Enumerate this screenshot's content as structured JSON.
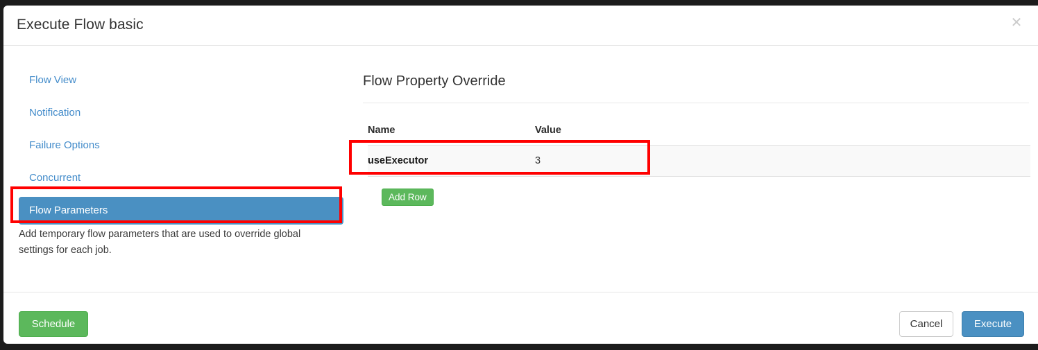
{
  "modal": {
    "title": "Execute Flow basic",
    "close_icon": "close-icon",
    "close_glyph": "✕"
  },
  "sidebar": {
    "items": [
      {
        "label": "Flow View",
        "active": false
      },
      {
        "label": "Notification",
        "active": false
      },
      {
        "label": "Failure Options",
        "active": false
      },
      {
        "label": "Concurrent",
        "active": false
      },
      {
        "label": "Flow Parameters",
        "active": true
      }
    ],
    "description": "Add temporary flow parameters that are used to override global settings for each job."
  },
  "main": {
    "heading": "Flow Property Override",
    "table": {
      "columns": [
        "Name",
        "Value"
      ],
      "rows": [
        {
          "name": "useExecutor",
          "value": "3"
        }
      ]
    },
    "add_row_label": "Add Row"
  },
  "footer": {
    "schedule_label": "Schedule",
    "cancel_label": "Cancel",
    "execute_label": "Execute"
  },
  "colors": {
    "primary": "#4a90c2",
    "success": "#5cb85c",
    "link": "#428bca",
    "annotation": "#ff0000",
    "row_background": "#f9f9f9"
  }
}
